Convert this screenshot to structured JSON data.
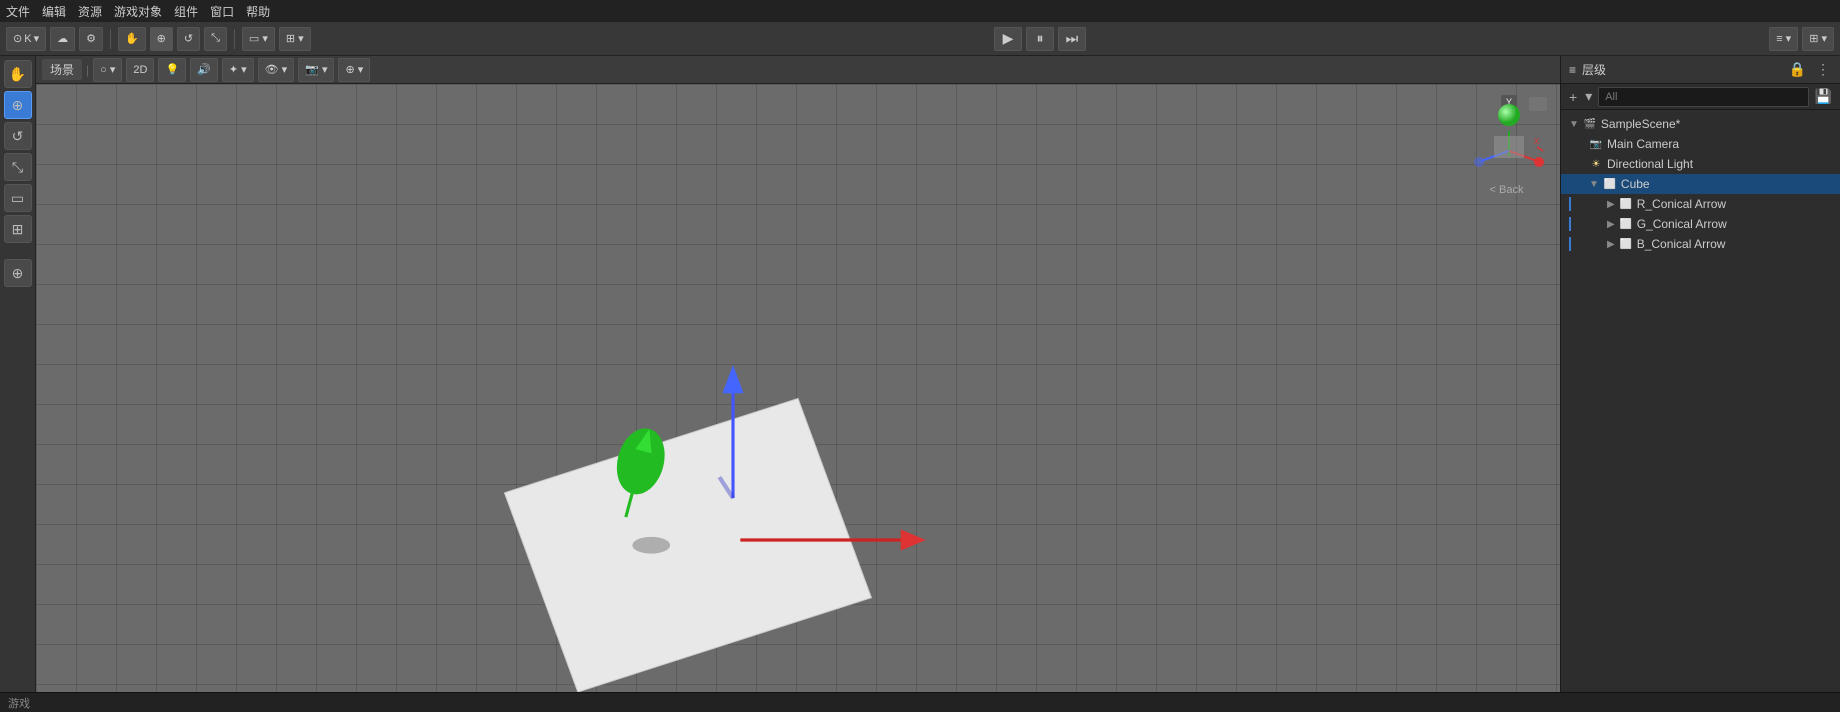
{
  "menu": {
    "items": [
      "文件",
      "编辑",
      "资源",
      "游戏对象",
      "组件",
      "窗口",
      "帮助"
    ]
  },
  "toolbar": {
    "profile_label": "K",
    "transform_buttons": [
      "移动",
      "旋转",
      "缩放",
      "矩形变换"
    ],
    "view_2d_label": "2D",
    "play_button": "▶",
    "pause_button": "⏸",
    "step_button": "⏭"
  },
  "scene": {
    "tab_label": "场景",
    "gizmo_back_label": "< Back"
  },
  "hierarchy": {
    "panel_title": "层级",
    "search_placeholder": "All",
    "items": [
      {
        "id": "samplescene",
        "label": "SampleScene*",
        "level": 0,
        "icon": "scene",
        "expanded": true
      },
      {
        "id": "maincamera",
        "label": "Main Camera",
        "level": 1,
        "icon": "camera"
      },
      {
        "id": "directionallight",
        "label": "Directional Light",
        "level": 1,
        "icon": "light"
      },
      {
        "id": "cube",
        "label": "Cube",
        "level": 1,
        "icon": "cube",
        "expanded": true,
        "selected": true
      },
      {
        "id": "r_conical",
        "label": "R_Conical Arrow",
        "level": 2,
        "icon": "mesh"
      },
      {
        "id": "g_conical",
        "label": "G_Conical Arrow",
        "level": 2,
        "icon": "mesh"
      },
      {
        "id": "b_conical",
        "label": "B_Conical Arrow",
        "level": 2,
        "icon": "mesh"
      }
    ]
  },
  "status": {
    "label": "游戏"
  }
}
